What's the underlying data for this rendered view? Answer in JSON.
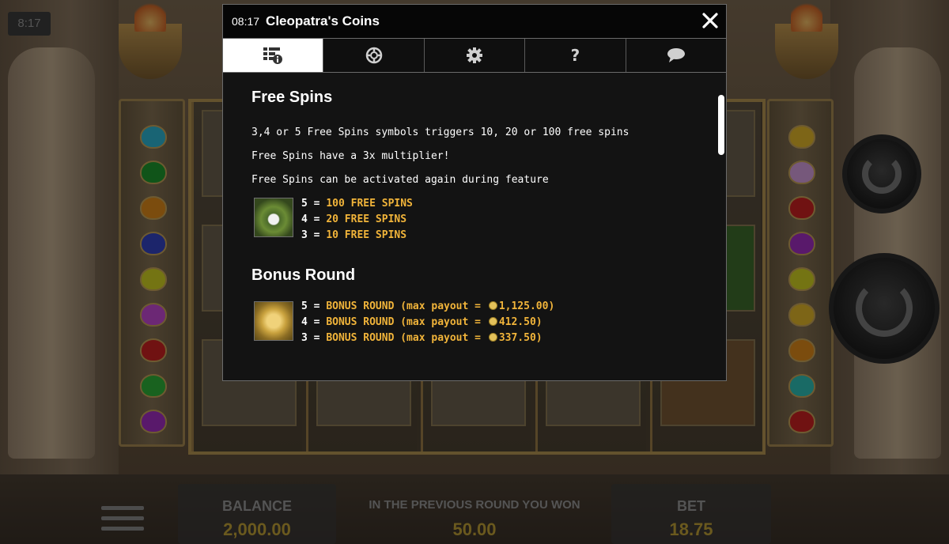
{
  "background_game": {
    "clock": "8:17",
    "balance_label": "BALANCE",
    "balance_value": "2,000.00",
    "win_label": "IN THE PREVIOUS ROUND YOU WON",
    "win_value": "50.00",
    "bet_label": "BET",
    "bet_value": "18.75"
  },
  "modal": {
    "time": "08:17",
    "title": "Cleopatra's Coins",
    "close_icon": "close-icon",
    "tabs": [
      {
        "icon": "paytable-info-icon",
        "active": true
      },
      {
        "icon": "chip-icon",
        "active": false
      },
      {
        "icon": "gear-icon",
        "active": false
      },
      {
        "icon": "question-icon",
        "label": "?",
        "active": false
      },
      {
        "icon": "chat-bubble-icon",
        "active": false
      }
    ],
    "free_spins": {
      "title": "Free Spins",
      "lines": [
        "3,4 or 5 Free Spins symbols triggers 10, 20 or 100 free spins",
        "Free Spins have a 3x multiplier!",
        "Free Spins can be activated again during feature"
      ],
      "pays": [
        {
          "count": "5",
          "eq": " = ",
          "text": "100 FREE SPINS"
        },
        {
          "count": "4",
          "eq": " = ",
          "text": "20 FREE SPINS"
        },
        {
          "count": "3",
          "eq": " = ",
          "text": "10 FREE SPINS"
        }
      ]
    },
    "bonus_round": {
      "title": "Bonus Round",
      "pays": [
        {
          "count": "5",
          "eq": " = ",
          "text": "BONUS ROUND (max payout = ",
          "amount": "1,125.00",
          "close": ")"
        },
        {
          "count": "4",
          "eq": " = ",
          "text": "BONUS ROUND (max payout = ",
          "amount": "412.50",
          "close": ")"
        },
        {
          "count": "3",
          "eq": " = ",
          "text": "BONUS ROUND (max payout = ",
          "amount": "337.50",
          "close": ")"
        }
      ]
    }
  },
  "colors": {
    "accent_gold": "#f1b43a",
    "modal_bg": "#131313",
    "active_tab_bg": "#ffffff"
  }
}
